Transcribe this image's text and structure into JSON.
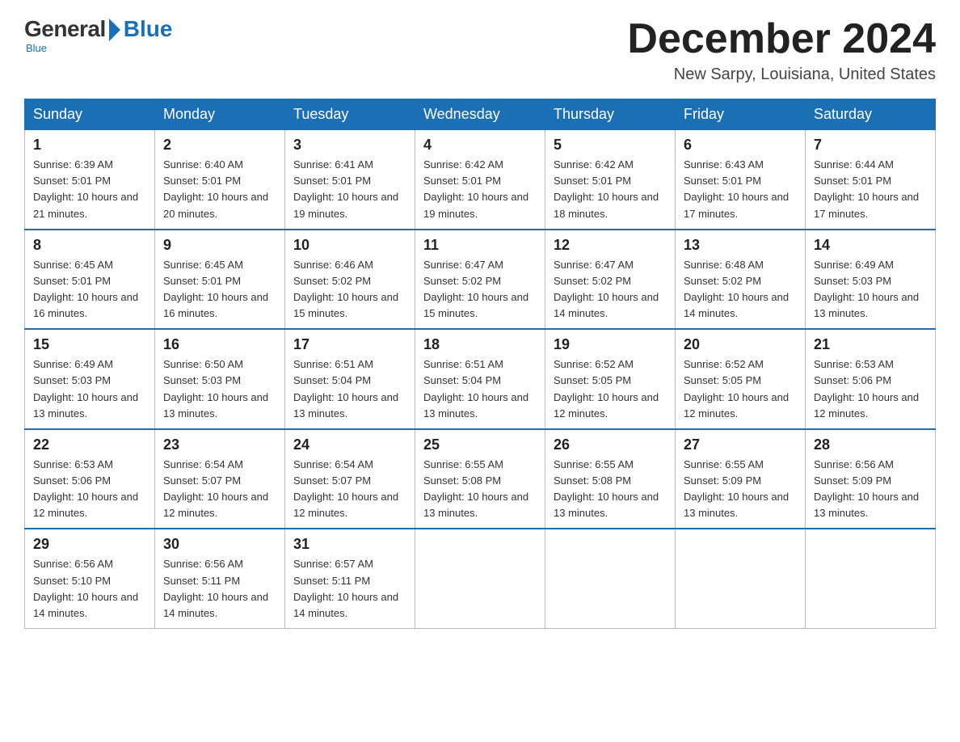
{
  "logo": {
    "general": "General",
    "blue": "Blue",
    "subtitle": "Blue"
  },
  "header": {
    "month_title": "December 2024",
    "location": "New Sarpy, Louisiana, United States"
  },
  "days_of_week": [
    "Sunday",
    "Monday",
    "Tuesday",
    "Wednesday",
    "Thursday",
    "Friday",
    "Saturday"
  ],
  "weeks": [
    [
      {
        "day": "1",
        "sunrise": "6:39 AM",
        "sunset": "5:01 PM",
        "daylight": "10 hours and 21 minutes."
      },
      {
        "day": "2",
        "sunrise": "6:40 AM",
        "sunset": "5:01 PM",
        "daylight": "10 hours and 20 minutes."
      },
      {
        "day": "3",
        "sunrise": "6:41 AM",
        "sunset": "5:01 PM",
        "daylight": "10 hours and 19 minutes."
      },
      {
        "day": "4",
        "sunrise": "6:42 AM",
        "sunset": "5:01 PM",
        "daylight": "10 hours and 19 minutes."
      },
      {
        "day": "5",
        "sunrise": "6:42 AM",
        "sunset": "5:01 PM",
        "daylight": "10 hours and 18 minutes."
      },
      {
        "day": "6",
        "sunrise": "6:43 AM",
        "sunset": "5:01 PM",
        "daylight": "10 hours and 17 minutes."
      },
      {
        "day": "7",
        "sunrise": "6:44 AM",
        "sunset": "5:01 PM",
        "daylight": "10 hours and 17 minutes."
      }
    ],
    [
      {
        "day": "8",
        "sunrise": "6:45 AM",
        "sunset": "5:01 PM",
        "daylight": "10 hours and 16 minutes."
      },
      {
        "day": "9",
        "sunrise": "6:45 AM",
        "sunset": "5:01 PM",
        "daylight": "10 hours and 16 minutes."
      },
      {
        "day": "10",
        "sunrise": "6:46 AM",
        "sunset": "5:02 PM",
        "daylight": "10 hours and 15 minutes."
      },
      {
        "day": "11",
        "sunrise": "6:47 AM",
        "sunset": "5:02 PM",
        "daylight": "10 hours and 15 minutes."
      },
      {
        "day": "12",
        "sunrise": "6:47 AM",
        "sunset": "5:02 PM",
        "daylight": "10 hours and 14 minutes."
      },
      {
        "day": "13",
        "sunrise": "6:48 AM",
        "sunset": "5:02 PM",
        "daylight": "10 hours and 14 minutes."
      },
      {
        "day": "14",
        "sunrise": "6:49 AM",
        "sunset": "5:03 PM",
        "daylight": "10 hours and 13 minutes."
      }
    ],
    [
      {
        "day": "15",
        "sunrise": "6:49 AM",
        "sunset": "5:03 PM",
        "daylight": "10 hours and 13 minutes."
      },
      {
        "day": "16",
        "sunrise": "6:50 AM",
        "sunset": "5:03 PM",
        "daylight": "10 hours and 13 minutes."
      },
      {
        "day": "17",
        "sunrise": "6:51 AM",
        "sunset": "5:04 PM",
        "daylight": "10 hours and 13 minutes."
      },
      {
        "day": "18",
        "sunrise": "6:51 AM",
        "sunset": "5:04 PM",
        "daylight": "10 hours and 13 minutes."
      },
      {
        "day": "19",
        "sunrise": "6:52 AM",
        "sunset": "5:05 PM",
        "daylight": "10 hours and 12 minutes."
      },
      {
        "day": "20",
        "sunrise": "6:52 AM",
        "sunset": "5:05 PM",
        "daylight": "10 hours and 12 minutes."
      },
      {
        "day": "21",
        "sunrise": "6:53 AM",
        "sunset": "5:06 PM",
        "daylight": "10 hours and 12 minutes."
      }
    ],
    [
      {
        "day": "22",
        "sunrise": "6:53 AM",
        "sunset": "5:06 PM",
        "daylight": "10 hours and 12 minutes."
      },
      {
        "day": "23",
        "sunrise": "6:54 AM",
        "sunset": "5:07 PM",
        "daylight": "10 hours and 12 minutes."
      },
      {
        "day": "24",
        "sunrise": "6:54 AM",
        "sunset": "5:07 PM",
        "daylight": "10 hours and 12 minutes."
      },
      {
        "day": "25",
        "sunrise": "6:55 AM",
        "sunset": "5:08 PM",
        "daylight": "10 hours and 13 minutes."
      },
      {
        "day": "26",
        "sunrise": "6:55 AM",
        "sunset": "5:08 PM",
        "daylight": "10 hours and 13 minutes."
      },
      {
        "day": "27",
        "sunrise": "6:55 AM",
        "sunset": "5:09 PM",
        "daylight": "10 hours and 13 minutes."
      },
      {
        "day": "28",
        "sunrise": "6:56 AM",
        "sunset": "5:09 PM",
        "daylight": "10 hours and 13 minutes."
      }
    ],
    [
      {
        "day": "29",
        "sunrise": "6:56 AM",
        "sunset": "5:10 PM",
        "daylight": "10 hours and 14 minutes."
      },
      {
        "day": "30",
        "sunrise": "6:56 AM",
        "sunset": "5:11 PM",
        "daylight": "10 hours and 14 minutes."
      },
      {
        "day": "31",
        "sunrise": "6:57 AM",
        "sunset": "5:11 PM",
        "daylight": "10 hours and 14 minutes."
      },
      null,
      null,
      null,
      null
    ]
  ]
}
